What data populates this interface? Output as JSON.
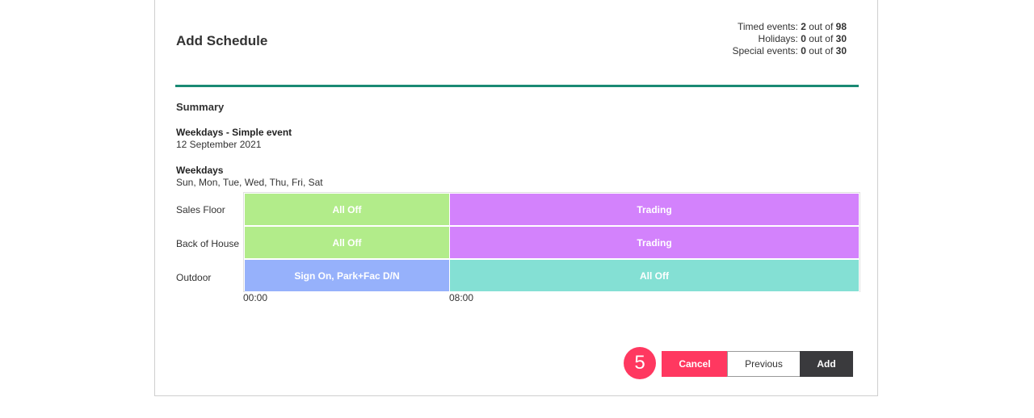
{
  "dialog": {
    "title": "Add Schedule",
    "counts": [
      {
        "label": "Timed events:",
        "used": "2",
        "sep": "out of",
        "total": "98"
      },
      {
        "label": "Holidays:",
        "used": "0",
        "sep": "out of",
        "total": "30"
      },
      {
        "label": "Special events:",
        "used": "0",
        "sep": "out of",
        "total": "30"
      }
    ],
    "summary_heading": "Summary",
    "event": {
      "heading": "Weekdays - Simple event",
      "date": "12 September 2021"
    },
    "days": {
      "heading": "Weekdays",
      "list": "Sun, Mon, Tue, Wed, Thu, Fri, Sat"
    }
  },
  "timeline": {
    "rows": [
      {
        "label": "Sales Floor",
        "segments": [
          {
            "text": "All Off",
            "color": "#b2ec8a"
          },
          {
            "text": "Trading",
            "color": "#d382fc"
          }
        ]
      },
      {
        "label": "Back of House",
        "segments": [
          {
            "text": "All Off",
            "color": "#b2ec8a"
          },
          {
            "text": "Trading",
            "color": "#d382fc"
          }
        ]
      },
      {
        "label": "Outdoor",
        "segments": [
          {
            "text": "Sign On, Park+Fac D/N",
            "color": "#96b1fb"
          },
          {
            "text": "All Off",
            "color": "#84e0d4"
          }
        ]
      }
    ],
    "ticks": [
      "00:00",
      "08:00"
    ]
  },
  "footer": {
    "step_number": "5",
    "cancel_label": "Cancel",
    "previous_label": "Previous",
    "add_label": "Add"
  },
  "colors": {
    "accent": "#1a8a74",
    "danger": "#ff3860",
    "dark": "#3a3a3d"
  }
}
